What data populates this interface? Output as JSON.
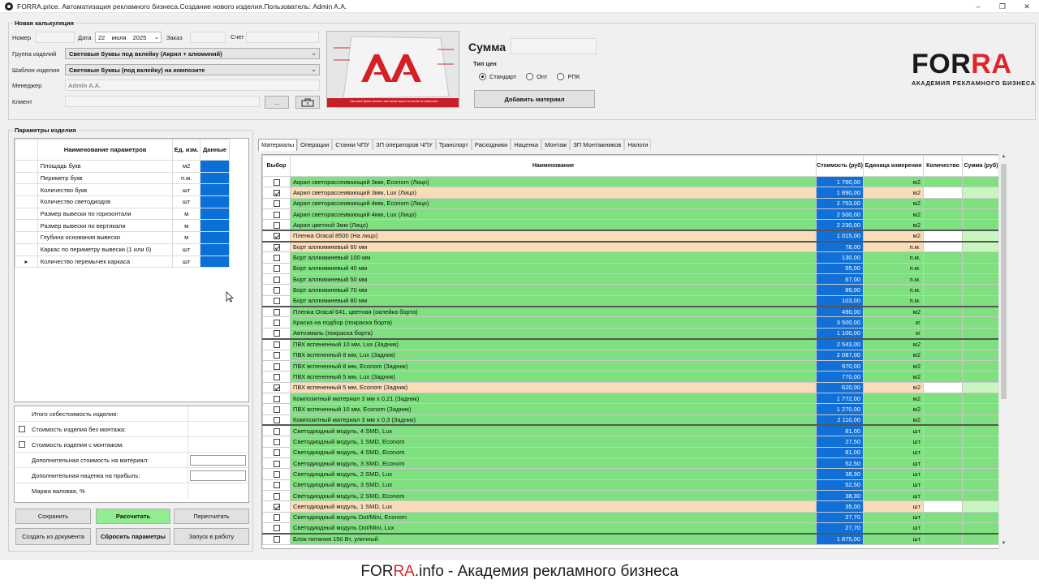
{
  "window": {
    "title": "FORRA.price. Автоматизация рекламного бизнеса.Создание нового изделия.Пользователь: Admin A.A.",
    "controls": [
      "–",
      "❐",
      "✕"
    ]
  },
  "calc": {
    "title": "Новая калькуляция",
    "number_label": "Номер",
    "date_label": "Дата",
    "date_day": "22",
    "date_month": "июля",
    "date_year": "2025",
    "order_label": "Заказ",
    "account_label": "Счет",
    "group_label": "Группа изделий",
    "group_value": "Световые буквы под вклейку (Акрил + алюминий)",
    "template_label": "Шаблон изделия",
    "template_value": "Световые буквы (под вклейку) на композите",
    "manager_label": "Менеджер",
    "manager_value": "Admin A.A.",
    "client_label": "Клиент",
    "ellipsis_button": "...",
    "sum_label": "Сумма",
    "price_type_label": "Тип цен",
    "price_types": [
      "Стандарт",
      "Опт",
      "РПК"
    ],
    "add_material_button": "Добавить материал",
    "preview_caption": "Световые буквы нижнего светления акрил на основе из композита"
  },
  "logo": {
    "word_a": "FOR",
    "word_b": "RA",
    "subtitle": "АКАДЕМИЯ РЕКЛАМНОГО БИЗНЕСА"
  },
  "params": {
    "title": "Параметры изделия",
    "headers": {
      "name": "Наименование параметров",
      "unit": "Ед. изм.",
      "data": "Данные"
    },
    "rows": [
      {
        "name": "Площадь букв",
        "unit": "м2"
      },
      {
        "name": "Периметр букв",
        "unit": "п.м."
      },
      {
        "name": "Количество букв",
        "unit": "шт"
      },
      {
        "name": "Количество светодиодов",
        "unit": "шт"
      },
      {
        "name": "Размер вывески по горизонтали",
        "unit": "м"
      },
      {
        "name": "Размер вывески по вертикали",
        "unit": "м"
      },
      {
        "name": "Глубина основания вывески",
        "unit": "м"
      },
      {
        "name": "Каркас по периметру вывески (1 или 0)",
        "unit": "шт"
      },
      {
        "name": "Количество перемычек каркаса",
        "unit": "шт"
      }
    ]
  },
  "summary": {
    "total_cost": "Итого себестоимость изделия:",
    "cost_without_install": "Стоимость изделия без монтажа:",
    "cost_with_install": "Стоимость изделия с монтажом:",
    "extra_material": "Дополнительная стоимость на материал:",
    "extra_markup": "Дополнительная  наценка на прибыль:",
    "gross_margin": "Маржа валовая, %"
  },
  "buttons": {
    "save": "Сохранить",
    "calculate": "Рассчитать",
    "recalculate": "Пересчитать",
    "create_from_doc": "Создать из документа",
    "reset": "Сбросить параметры",
    "launch": "Запуск в работу"
  },
  "tabs": [
    "Материалы",
    "Операции",
    "Станки ЧПУ",
    "ЗП операторов ЧПУ",
    "Транспорт",
    "Расходники",
    "Наценка",
    "Монтаж",
    "ЗП Монтажников",
    "Налоги"
  ],
  "materials": {
    "headers": {
      "select": "Выбор",
      "name": "Наименование",
      "cost": "Стоимость (руб)",
      "unit": "Единица измерения",
      "qty": "Количество",
      "sum": "Сумма (руб)"
    },
    "rows": [
      {
        "name": "Акрил светорассеивающий 3мм, Econom (Лицо)",
        "cost": "1 760,00",
        "unit": "м2",
        "checked": false
      },
      {
        "name": "Акрил светорассеивающий 3мм, Lux (Лицо)",
        "cost": "1 890,00",
        "unit": "м2",
        "checked": true
      },
      {
        "name": "Акрил светорассеивающий 4мм,  Econom (Лицо)",
        "cost": "2 753,00",
        "unit": "м2",
        "checked": false
      },
      {
        "name": "Акрил светорассеивающий 4мм, Lux (Лицо)",
        "cost": "2 500,00",
        "unit": "м2",
        "checked": false
      },
      {
        "name": "Акрил цветной 3мм (Лицо)",
        "cost": "2 230,00",
        "unit": "м2",
        "checked": false
      },
      {
        "name": "Пленка Oracal 8500 (На лицо)",
        "cost": "1 015,00",
        "unit": "м2",
        "checked": true,
        "sep": true
      },
      {
        "name": "Борт аллюминевый 60 мм",
        "cost": "78,00",
        "unit": "п.м.",
        "checked": true,
        "sep": true
      },
      {
        "name": "Борт аллюминевый 100 мм",
        "cost": "130,00",
        "unit": "п.м.",
        "checked": false
      },
      {
        "name": "Борт аллюминевый 40 мм",
        "cost": "55,00",
        "unit": "п.м.",
        "checked": false
      },
      {
        "name": "Борт аллюминевый 50 мм",
        "cost": "67,00",
        "unit": "п.м.",
        "checked": false
      },
      {
        "name": "Борт аллюминевый 70 мм",
        "cost": "89,00",
        "unit": "п.м.",
        "checked": false
      },
      {
        "name": "Борт аллюминевый 80 мм",
        "cost": "103,00",
        "unit": "п.м.",
        "checked": false
      },
      {
        "name": "Пленка Oracal 641, цветная (оклейка борта)",
        "cost": "490,00",
        "unit": "м2",
        "checked": false,
        "sep": true
      },
      {
        "name": "Краска на подбор (покраска борта)",
        "cost": "3 500,00",
        "unit": "кг",
        "checked": false
      },
      {
        "name": "Автоэмаль (покраска борта)",
        "cost": "1 100,00",
        "unit": "кг",
        "checked": false
      },
      {
        "name": "ПВХ вспененный 10 мм, Lux (Задник)",
        "cost": "2 543,00",
        "unit": "м2",
        "checked": false,
        "sep": true
      },
      {
        "name": "ПВХ вспененный 8 мм, Lux (Задник)",
        "cost": "2 087,00",
        "unit": "м2",
        "checked": false
      },
      {
        "name": "ПВХ вспененный 8 мм, Econom (Задник)",
        "cost": "970,00",
        "unit": "м2",
        "checked": false
      },
      {
        "name": "ПВХ вспененный 5 мм, Lux (Задник)",
        "cost": "770,00",
        "unit": "м2",
        "checked": false
      },
      {
        "name": "ПВХ вспененный 5 мм, Econom (Задник)",
        "cost": "620,00",
        "unit": "м2",
        "checked": true
      },
      {
        "name": "Композитный материал 3 мм х 0,21 (Задник)",
        "cost": "1 772,00",
        "unit": "м2",
        "checked": false
      },
      {
        "name": "ПВХ вспененный 10 мм, Econom (Задник)",
        "cost": "1 270,00",
        "unit": "м2",
        "checked": false
      },
      {
        "name": "Композитный материал 3 мм х 0,3 (Задник)",
        "cost": "2 110,00",
        "unit": "м2",
        "checked": false
      },
      {
        "name": "Светодиодный модуль, 4 SMD, Lux",
        "cost": "81,00",
        "unit": "шт",
        "checked": false,
        "sep": true
      },
      {
        "name": "Светодиодный модуль, 1 SMD, Econom",
        "cost": "27,50",
        "unit": "шт",
        "checked": false
      },
      {
        "name": "Светодиодный модуль, 4 SMD, Econom",
        "cost": "81,00",
        "unit": "шт",
        "checked": false
      },
      {
        "name": "Светодиодный модуль, 3 SMD, Econom",
        "cost": "52,50",
        "unit": "шт",
        "checked": false
      },
      {
        "name": "Светодиодный модуль, 2 SMD, Lux",
        "cost": "38,30",
        "unit": "шт",
        "checked": false
      },
      {
        "name": "Светодиодный модуль, 3 SMD, Lux",
        "cost": "52,50",
        "unit": "шт",
        "checked": false
      },
      {
        "name": "Светодиодный модуль, 2 SMD, Econom",
        "cost": "38,30",
        "unit": "шт",
        "checked": false
      },
      {
        "name": "Светодиодный модуль, 1 SMD, Lux",
        "cost": "35,00",
        "unit": "шт",
        "checked": true
      },
      {
        "name": "Светодиодный модуль Dot/Mini, Econom",
        "cost": "27,70",
        "unit": "шт",
        "checked": false
      },
      {
        "name": "Светодиодный модуль Dot/Mini, Lux",
        "cost": "27,70",
        "unit": "шт",
        "checked": false
      },
      {
        "name": "Блок питания 150 Вт, уличный",
        "cost": "1 875,00",
        "unit": "шт",
        "checked": false,
        "sep": true
      }
    ]
  },
  "footer": {
    "brand_a": "FOR",
    "brand_b": "RA",
    "rest": ".info - Академия рекламного бизнеса"
  },
  "colors": {
    "selected_row": "#fbdcb9",
    "unselected_row": "#7fe07f",
    "cost_cell": "#1070d8",
    "accent": "#e0242a"
  }
}
